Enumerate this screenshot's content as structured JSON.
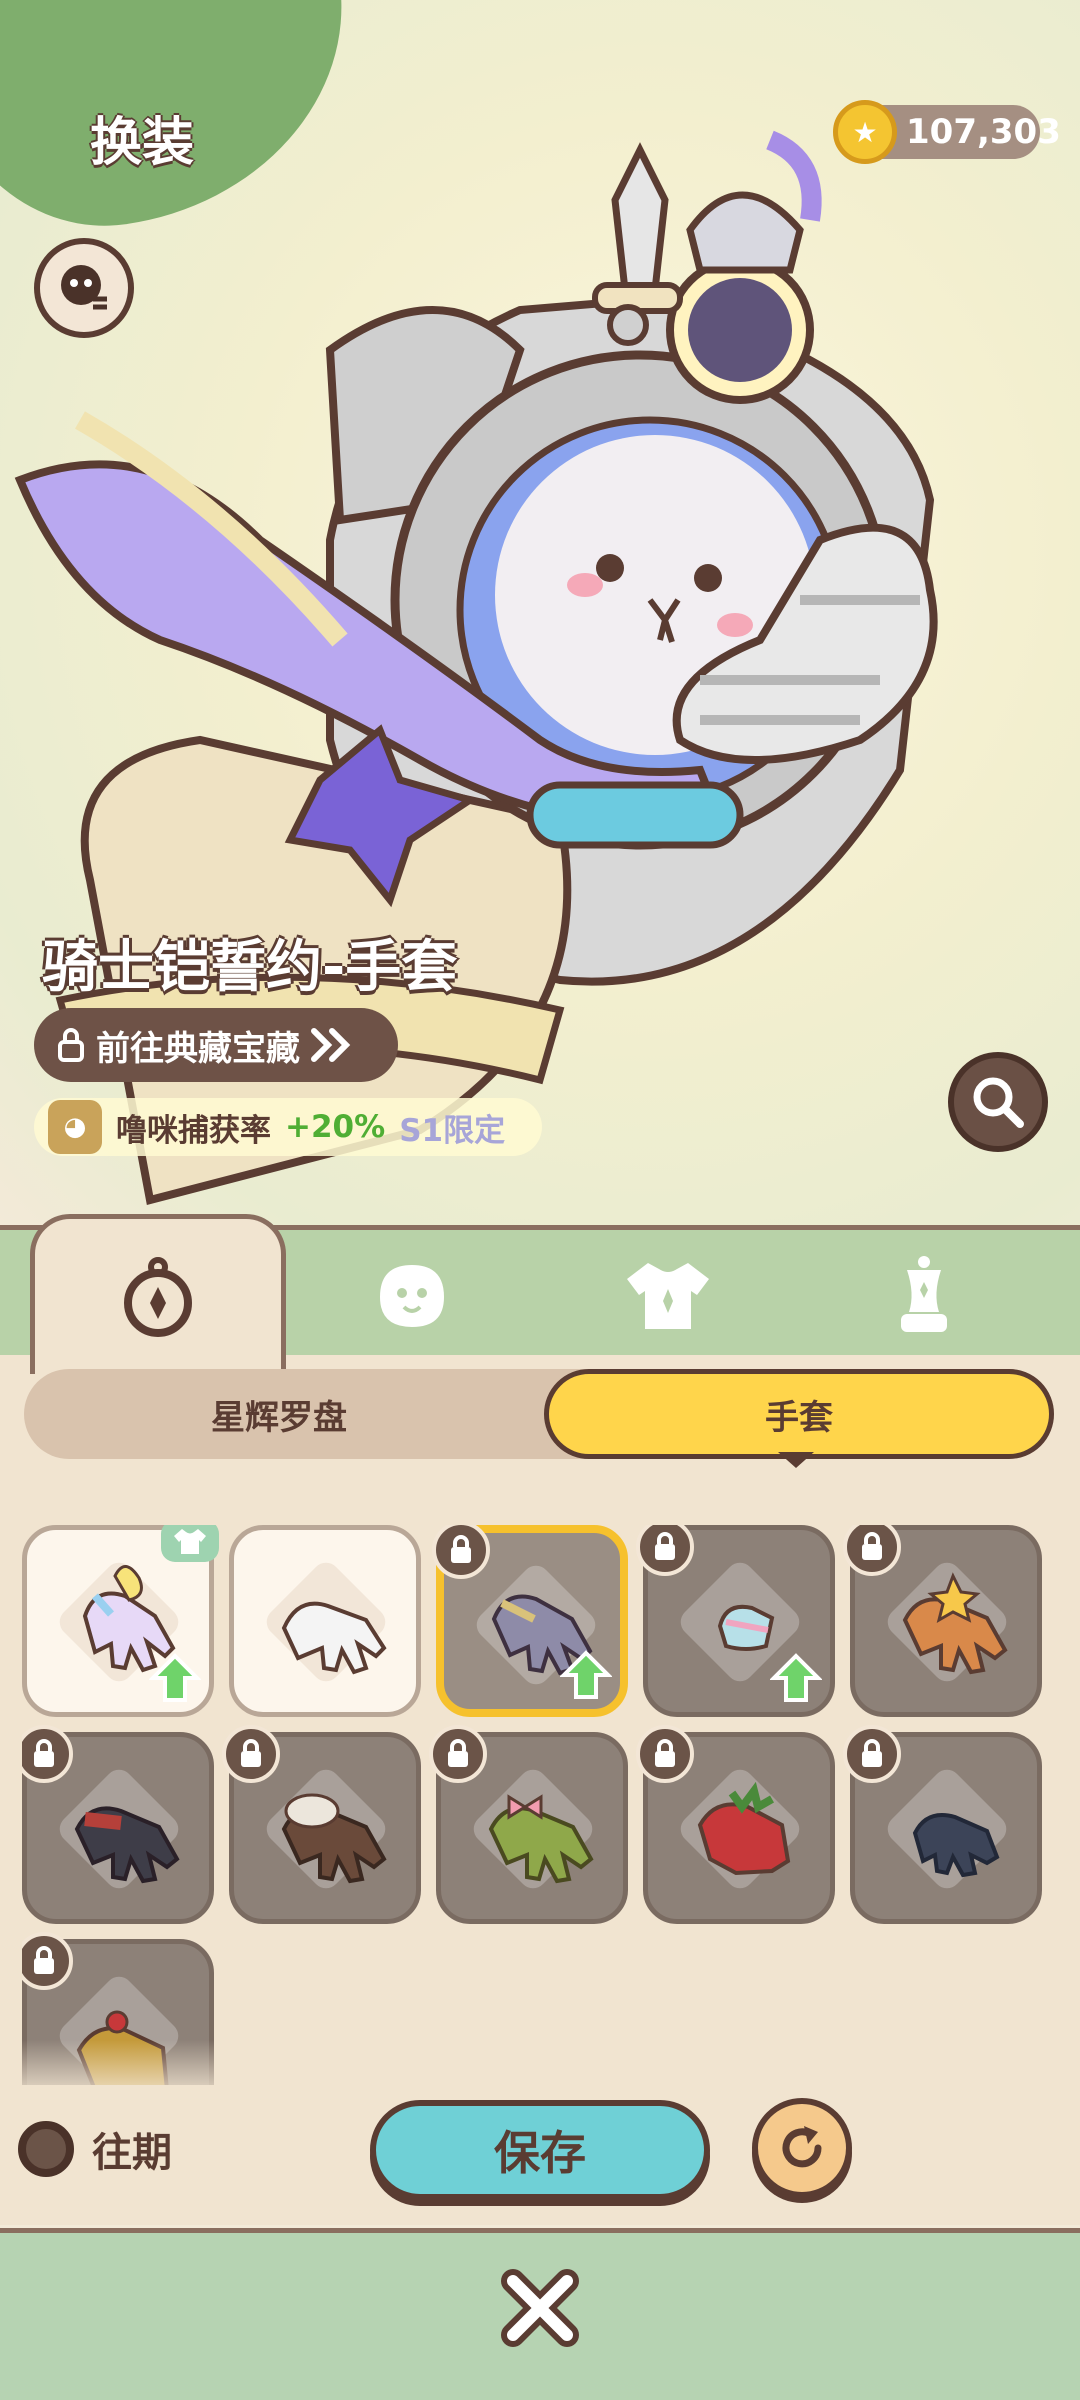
{
  "header": {
    "title": "换装",
    "coins": "107,303",
    "coin_icon": "coin-icon"
  },
  "showcase": {
    "item_name": "骑士铠誓约-手套",
    "goto_label": "前往典藏宝藏",
    "capture_label": "噜咪捕获率",
    "capture_value": "+20%",
    "capture_tag": "S1限定"
  },
  "tabs": [
    {
      "icon": "compass-icon",
      "active": true
    },
    {
      "icon": "face-icon",
      "active": false
    },
    {
      "icon": "outfit-icon",
      "active": false
    },
    {
      "icon": "mannequin-icon",
      "active": false
    }
  ],
  "subtabs": {
    "left": "星辉罗盘",
    "right": "手套",
    "active": "right"
  },
  "items": [
    {
      "name": "pastel-glove",
      "owned": true,
      "locked": false,
      "upgrade": true,
      "equipped_badge": true
    },
    {
      "name": "white-glove",
      "owned": true,
      "locked": false,
      "upgrade": false
    },
    {
      "name": "knight-gauntlet",
      "owned": false,
      "locked": true,
      "upgrade": true,
      "selected": true
    },
    {
      "name": "cake-glove",
      "owned": false,
      "locked": true,
      "upgrade": true
    },
    {
      "name": "star-orange-glove",
      "owned": false,
      "locked": true,
      "upgrade": false
    },
    {
      "name": "black-red-glove",
      "owned": false,
      "locked": true,
      "upgrade": false
    },
    {
      "name": "fur-brown-glove",
      "owned": false,
      "locked": true,
      "upgrade": false
    },
    {
      "name": "bow-green-glove",
      "owned": false,
      "locked": true,
      "upgrade": false
    },
    {
      "name": "strawberry-glove",
      "owned": false,
      "locked": true,
      "upgrade": false
    },
    {
      "name": "navy-glove",
      "owned": false,
      "locked": true,
      "upgrade": false
    },
    {
      "name": "leaf-glove",
      "owned": false,
      "locked": true,
      "upgrade": false
    }
  ],
  "footer": {
    "past_label": "往期",
    "save_label": "保存"
  },
  "colors": {
    "accent_yellow": "#ffd54b",
    "save_teal": "#6fd0d6",
    "outline_brown": "#5a3c32",
    "capture_green": "#4fae34"
  }
}
